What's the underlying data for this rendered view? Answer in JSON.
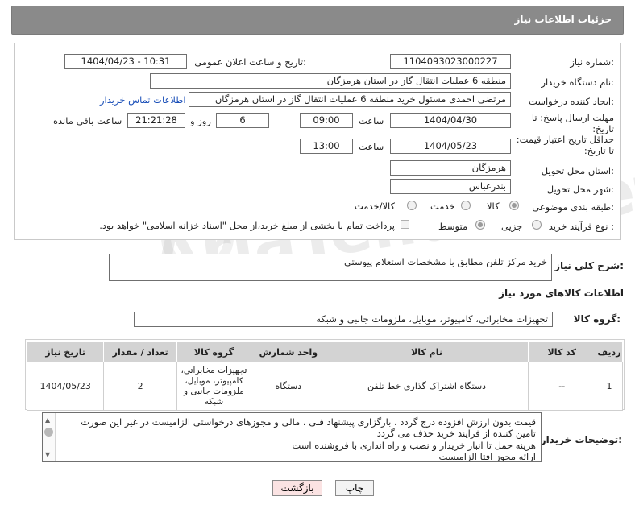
{
  "header": {
    "title": "جزئیات اطلاعات نیاز"
  },
  "fields": {
    "need_number_label": "شماره نیاز:",
    "need_number": "1104093023000227",
    "announce_label": "تاریخ و ساعت اعلان عمومی:",
    "announce_value": "1404/04/23 - 10:31",
    "buyer_org_label": "نام دستگاه خریدار:",
    "buyer_org": "منطقه 6 عملیات انتقال گاز در استان هرمزگان",
    "creator_label": "ایجاد کننده درخواست:",
    "creator": "مرتضی احمدی مسئول خرید منطقه 6 عملیات انتقال گاز در استان هرمزگان",
    "contact_link": "اطلاعات تماس خریدار",
    "deadline_label": "مهلت ارسال پاسخ: تا تاریخ:",
    "deadline_date": "1404/04/30",
    "time_label": "ساعت",
    "deadline_time": "09:00",
    "days_value": "6",
    "days_label": "روز و",
    "remaining_time": "21:21:28",
    "remaining_label": "ساعت باقی مانده",
    "min_validity_label": "حداقل تاریخ اعتبار قیمت: تا تاریخ:",
    "validity_date": "1404/05/23",
    "validity_time": "13:00",
    "province_label": "استان محل تحویل:",
    "province": "هرمزگان",
    "city_label": "شهر محل تحویل:",
    "city": "بندرعباس",
    "category_label": "طبقه بندی موضوعی:",
    "category_options": [
      "کالا",
      "خدمت",
      "کالا/خدمت"
    ],
    "process_label": "نوع فرآیند خرید :",
    "process_options": [
      "جزیی",
      "متوسط"
    ],
    "payment_note": "پرداخت تمام یا بخشی از مبلغ خرید،از محل \"اسناد خزانه اسلامی\" خواهد بود."
  },
  "summary": {
    "label": "شرح کلی نیاز:",
    "value": "خرید مرکز تلفن مطابق با مشخصات استعلام پیوستی"
  },
  "goods_info_title": "اطلاعات کالاهای مورد نیاز",
  "goods_group": {
    "label": "گروه کالا:",
    "value": "تجهیزات مخابراتی، کامپیوتر، موبایل، ملزومات جانبی و شبکه"
  },
  "table": {
    "headers": [
      "ردیف",
      "کد کالا",
      "نام کالا",
      "واحد شمارش",
      "گروه کالا",
      "تعداد / مقدار",
      "تاریخ نیاز"
    ],
    "rows": [
      [
        "1",
        "--",
        "دستگاه اشتراک گذاری خط تلفن",
        "دستگاه",
        "تجهیزات مخابراتی، کامپیوتر، موبایل، ملزومات جانبی و شبکه",
        "2",
        "1404/05/23"
      ]
    ]
  },
  "buyer_notes": {
    "label": "توضیحات خریدار:",
    "lines": [
      "قیمت بدون ارزش افزوده درج گردد ، بارگزاری پیشنهاد فنی ، مالی و مجوزهای درخواستی الزامیست در غیر این صورت",
      "تامین کننده از فرایند خرید حذف می گردد",
      "هزینه حمل تا انبار خریدار و نصب و راه اندازی با فروشنده است",
      "ارائه مجوز افتا الزامیست"
    ]
  },
  "buttons": {
    "print": "چاپ",
    "back": "بازگشت"
  },
  "watermark": "AriaTender.net"
}
